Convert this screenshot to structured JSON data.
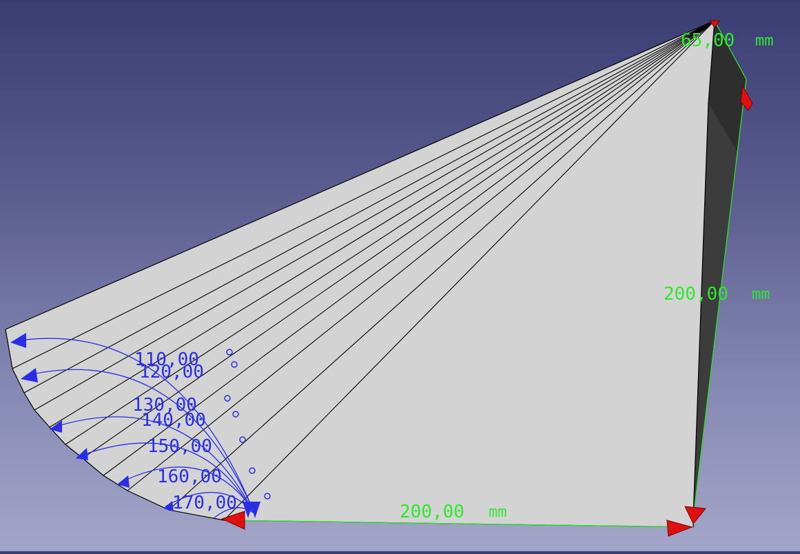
{
  "scene": {
    "background_top": "#3a3d72",
    "background_bottom": "#a3a5c8",
    "face_color": "#d3d3d3",
    "side_face_color": "#3c3c3c",
    "edge_color": "#000000",
    "linear_dimension_color": "#2ee82e",
    "angular_dimension_color": "#2a2ee6",
    "arrow_color": "#e01010"
  },
  "dimensions": {
    "linear": [
      {
        "id": "top",
        "value": "65,00",
        "unit": "mm"
      },
      {
        "id": "right",
        "value": "200,00",
        "unit": "mm"
      },
      {
        "id": "bottom",
        "value": "200,00",
        "unit": "mm"
      }
    ],
    "angular": [
      {
        "value": "110,00",
        "unit": "°"
      },
      {
        "value": "120,00",
        "unit": "°"
      },
      {
        "value": "130,00",
        "unit": "°"
      },
      {
        "value": "140,00",
        "unit": "°"
      },
      {
        "value": "150,00",
        "unit": "°"
      },
      {
        "value": "160,00",
        "unit": "°"
      },
      {
        "value": "170,00",
        "unit": "°"
      }
    ]
  }
}
